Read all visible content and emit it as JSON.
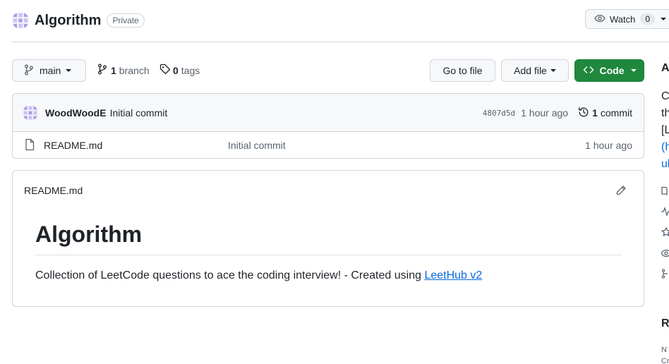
{
  "repo": {
    "name": "Algorithm",
    "visibility": "Private"
  },
  "watch": {
    "label": "Watch",
    "count": "0"
  },
  "toolbar": {
    "branch_name": "main",
    "branch_count": "1",
    "branch_label": "branch",
    "tag_count": "0",
    "tag_label": "tags",
    "goto_file": "Go to file",
    "add_file": "Add file",
    "code": "Code"
  },
  "latest_commit": {
    "author": "WoodWoodE",
    "message": "Initial commit",
    "sha": "4807d5d",
    "age": "1 hour ago",
    "commit_count": "1",
    "commit_label": "commit"
  },
  "files": [
    {
      "name": "README.md",
      "commit_message": "Initial commit",
      "age": "1 hour ago"
    }
  ],
  "readme": {
    "file_title": "README.md",
    "heading": "Algorithm",
    "text_before_link": "Collection of LeetCode questions to ace the coding interview! - Created using ",
    "link_text": "LeetHub v2"
  },
  "sidebar": {
    "about_fragment": "A",
    "desc_fragments": [
      "C",
      "th",
      "[L",
      "(h",
      "ul"
    ],
    "releases_fragment": "R",
    "small_fragments": [
      "N",
      "Cr"
    ]
  },
  "colors": {
    "accent_green": "#1f883d",
    "link_blue": "#0969da",
    "border": "#d0d7de",
    "muted_text": "#59636e"
  },
  "icons": [
    "avatar-identicon",
    "eye-icon",
    "git-branch-icon",
    "tag-icon",
    "code-icon",
    "history-icon",
    "file-icon",
    "pencil-icon",
    "book-icon",
    "pulse-icon",
    "star-icon",
    "fork-icon"
  ]
}
